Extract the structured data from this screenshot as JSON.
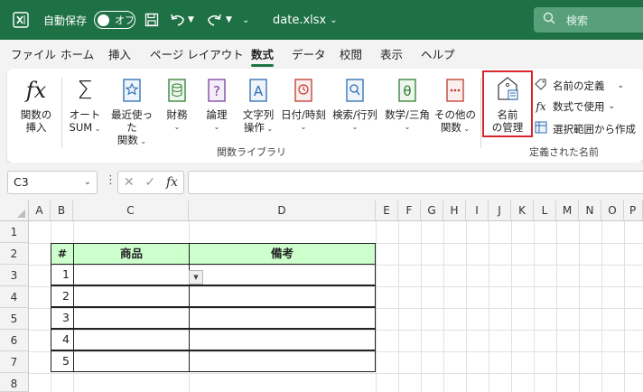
{
  "titlebar": {
    "autosave_label": "自動保存",
    "autosave_state": "オフ",
    "filename": "date.xlsx",
    "search_placeholder": "検索"
  },
  "menu": [
    "ファイル",
    "ホーム",
    "挿入",
    "ページ レイアウト",
    "数式",
    "データ",
    "校閲",
    "表示",
    "ヘルプ"
  ],
  "active_menu": "数式",
  "ribbon": {
    "insert_function": [
      "関数の",
      "挿入"
    ],
    "autosum": [
      "オート",
      "SUM"
    ],
    "recent": [
      "最近使った",
      "関数"
    ],
    "financial": "財務",
    "logical": "論理",
    "text": [
      "文字列",
      "操作"
    ],
    "datetime": "日付/時刻",
    "lookup": "検索/行列",
    "math": "数学/三角",
    "more": [
      "その他の",
      "関数"
    ],
    "function_library_label": "関数ライブラリ",
    "name_manager": [
      "名前",
      "の管理"
    ],
    "define_name": "名前の定義",
    "use_in_formula": "数式で使用",
    "create_from_selection": "選択範囲から作成",
    "defined_names_label": "定義された名前"
  },
  "formula_bar": {
    "name_box": "C3",
    "fx": "fx"
  },
  "columns": [
    "A",
    "B",
    "C",
    "D",
    "E",
    "F",
    "G",
    "H",
    "I",
    "J",
    "K",
    "L",
    "M",
    "N",
    "O",
    "P"
  ],
  "rows": [
    "1",
    "2",
    "3",
    "4",
    "5",
    "6",
    "7",
    "8"
  ],
  "table": {
    "headers": [
      "#",
      "商品",
      "備考"
    ],
    "numbers": [
      "1",
      "2",
      "3",
      "4",
      "5"
    ]
  },
  "colors": {
    "title_bar": "#1e7145",
    "header_fill": "#ccffcc",
    "highlight": "#d9262b"
  }
}
